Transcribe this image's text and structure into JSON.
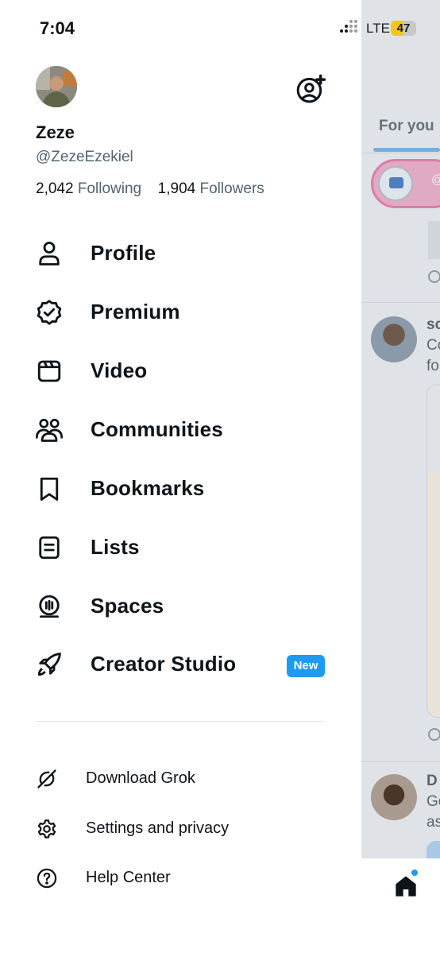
{
  "status_bar": {
    "time": "7:04",
    "network": "LTE",
    "battery": "47",
    "battery_level": 0.47
  },
  "profile": {
    "name": "Zeze",
    "handle": "@ZezeEzekiel",
    "following_count": "2,042",
    "following_label": "Following",
    "followers_count": "1,904",
    "followers_label": "Followers"
  },
  "menu": {
    "items": [
      {
        "label": "Profile",
        "icon": "person-icon"
      },
      {
        "label": "Premium",
        "icon": "verified-badge-icon"
      },
      {
        "label": "Video",
        "icon": "video-icon"
      },
      {
        "label": "Communities",
        "icon": "communities-icon"
      },
      {
        "label": "Bookmarks",
        "icon": "bookmark-icon"
      },
      {
        "label": "Lists",
        "icon": "list-icon"
      },
      {
        "label": "Spaces",
        "icon": "spaces-icon"
      },
      {
        "label": "Creator Studio",
        "icon": "rocket-icon",
        "badge": "New"
      }
    ],
    "secondary": [
      {
        "label": "Download Grok",
        "icon": "grok-icon"
      },
      {
        "label": "Settings and privacy",
        "icon": "gear-icon"
      },
      {
        "label": "Help Center",
        "icon": "question-circle-icon"
      }
    ]
  },
  "background_feed": {
    "tab": "For you",
    "post_1_name": "sc",
    "post_1_text_1": "Co",
    "post_1_text_2": "fo",
    "post_2_name": "D",
    "post_2_text_1": "Go",
    "post_2_text_2": "as",
    "mention": "@"
  },
  "colors": {
    "accent": "#1d9bf0",
    "text_primary": "#0f1419",
    "text_secondary": "#536471",
    "battery_fill": "#f5c518"
  }
}
